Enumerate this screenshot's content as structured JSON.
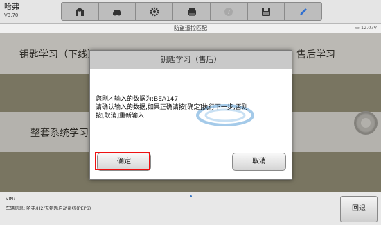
{
  "app": {
    "name": "哈弗",
    "version": "V3.70"
  },
  "toolbar": {
    "icons": [
      "home-icon",
      "car-icon",
      "gear-icon",
      "printer-icon",
      "help-icon",
      "save-icon",
      "pen-icon"
    ]
  },
  "status": {
    "title": "防盗遥控匹配",
    "battery": "12.07V"
  },
  "menu": {
    "item_key_learning": "钥匙学习（下线）",
    "item_after_sales": "售后学习",
    "item_full_system": "整套系统学习"
  },
  "dialog": {
    "title": "钥匙学习（售后）",
    "message_line1": "您刚才输入的数据为:BEA147",
    "message_line2": "请确认输入的数据,如果正确请按[确定]执行下一步,否则",
    "message_line3": "按[取消]重新输入",
    "confirm": "确定",
    "cancel": "取消"
  },
  "footer": {
    "vin": "VIN:",
    "vehicle_info": "车辆信息: 哈弗/H2/无钥匙启动系统(PEPS)",
    "back": "回退"
  },
  "colors": {
    "highlight": "#e11111",
    "accent": "#3a78c4"
  }
}
